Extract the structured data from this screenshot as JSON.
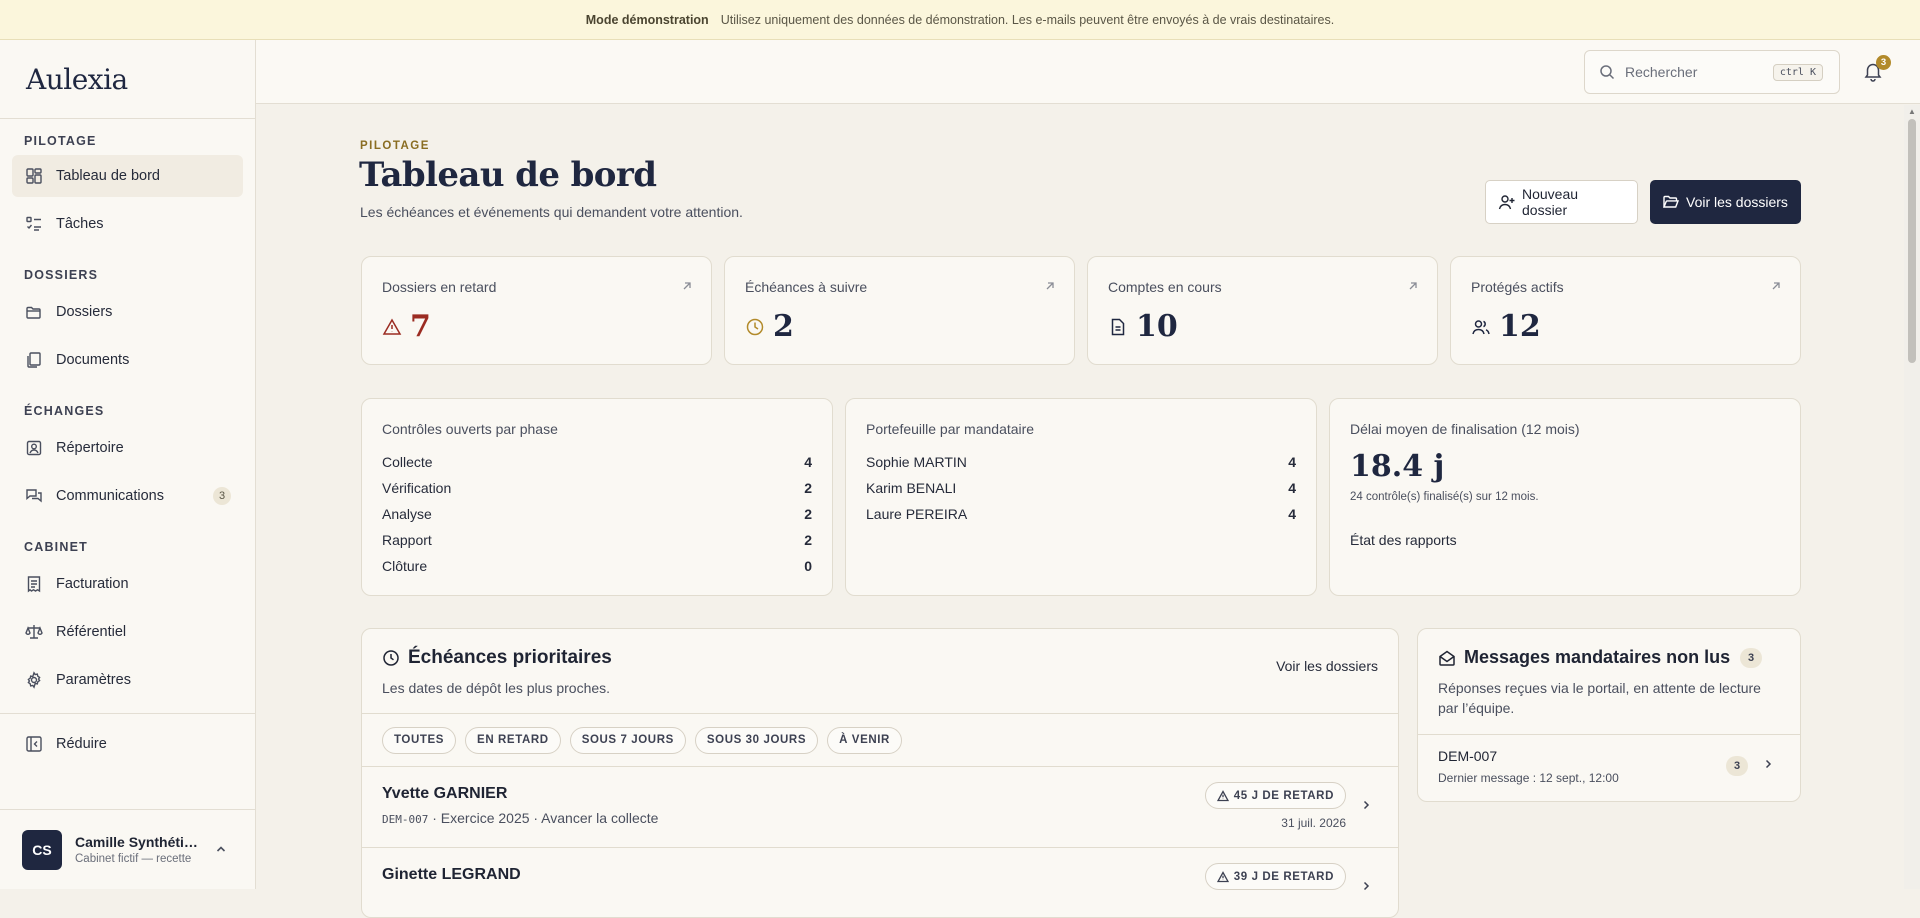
{
  "banner": {
    "title": "Mode démonstration",
    "text": "Utilisez uniquement des données de démonstration. Les e-mails peuvent être envoyés à de vrais destinataires."
  },
  "brand": "Aulexia",
  "sidebar": {
    "sections": [
      {
        "label": "PILOTAGE",
        "items": [
          {
            "label": "Tableau de bord",
            "icon": "dashboard-icon",
            "active": true
          },
          {
            "label": "Tâches",
            "icon": "tasks-icon"
          }
        ]
      },
      {
        "label": "DOSSIERS",
        "items": [
          {
            "label": "Dossiers",
            "icon": "folder-icon"
          },
          {
            "label": "Documents",
            "icon": "documents-icon"
          }
        ]
      },
      {
        "label": "ÉCHANGES",
        "items": [
          {
            "label": "Répertoire",
            "icon": "contacts-icon"
          },
          {
            "label": "Communications",
            "icon": "messages-icon",
            "count": "3"
          }
        ]
      },
      {
        "label": "CABINET",
        "items": [
          {
            "label": "Facturation",
            "icon": "invoice-icon"
          },
          {
            "label": "Référentiel",
            "icon": "scale-icon"
          },
          {
            "label": "Paramètres",
            "icon": "gear-icon"
          }
        ]
      }
    ],
    "collapse_label": "Réduire",
    "user": {
      "initials": "CS",
      "name": "Camille Synthétique",
      "subtitle": "Cabinet fictif — recette"
    }
  },
  "topbar": {
    "search_placeholder": "Rechercher",
    "search_shortcut": "ctrl K",
    "notifications_count": "3"
  },
  "header": {
    "eyebrow": "PILOTAGE",
    "title": "Tableau de bord",
    "subtitle": "Les échéances et événements qui demandent votre attention.",
    "new_button": "Nouveau dossier",
    "view_button": "Voir les dossiers"
  },
  "kpis": [
    {
      "label": "Dossiers en retard",
      "value": "7",
      "icon": "warning-icon"
    },
    {
      "label": "Échéances à suivre",
      "value": "2",
      "icon": "clock-icon"
    },
    {
      "label": "Comptes en cours",
      "value": "10",
      "icon": "document-icon"
    },
    {
      "label": "Protégés actifs",
      "value": "12",
      "icon": "users-icon"
    }
  ],
  "phases": {
    "title": "Contrôles ouverts par phase",
    "rows": [
      {
        "label": "Collecte",
        "value": "4"
      },
      {
        "label": "Vérification",
        "value": "2"
      },
      {
        "label": "Analyse",
        "value": "2"
      },
      {
        "label": "Rapport",
        "value": "2"
      },
      {
        "label": "Clôture",
        "value": "0"
      }
    ]
  },
  "portfolio": {
    "title": "Portefeuille par mandataire",
    "rows": [
      {
        "label": "Sophie MARTIN",
        "value": "4"
      },
      {
        "label": "Karim BENALI",
        "value": "4"
      },
      {
        "label": "Laure PEREIRA",
        "value": "4"
      }
    ]
  },
  "delay": {
    "title": "Délai moyen de finalisation (12 mois)",
    "value": "18.4 j",
    "note": "24 contrôle(s) finalisé(s) sur 12 mois.",
    "link": "État des rapports"
  },
  "deadlines": {
    "title": "Échéances prioritaires",
    "subtitle": "Les dates de dépôt les plus proches.",
    "link": "Voir les dossiers",
    "filters": [
      "TOUTES",
      "EN RETARD",
      "SOUS 7 JOURS",
      "SOUS 30 JOURS",
      "À VENIR"
    ],
    "items": [
      {
        "name": "Yvette GARNIER",
        "code": "DEM-007",
        "meta": " · Exercice 2025 · Avancer la collecte",
        "badge": "45 J DE RETARD",
        "date": "31 juil. 2026"
      },
      {
        "name": "Ginette LEGRAND",
        "code": "",
        "meta": "",
        "badge": "39 J DE RETARD",
        "date": ""
      }
    ]
  },
  "messages": {
    "title": "Messages mandataires non lus",
    "count": "3",
    "subtitle": "Réponses reçues via le portail, en attente de lecture par l’équipe.",
    "items": [
      {
        "code": "DEM-007",
        "last": "Dernier message : 12 sept., 12:00",
        "count": "3"
      }
    ]
  }
}
